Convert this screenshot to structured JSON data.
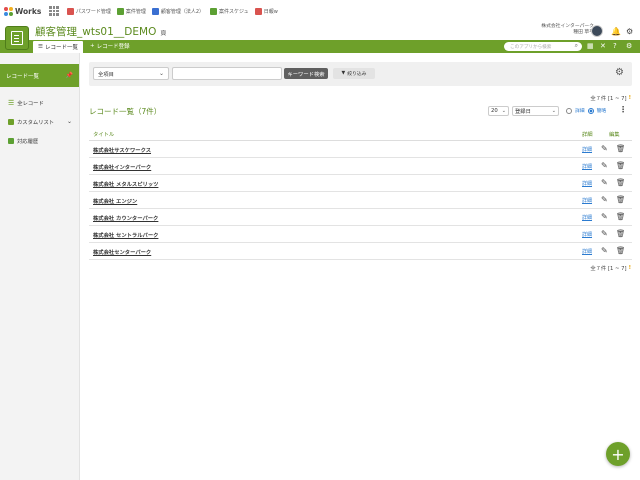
{
  "topbar": {
    "logo_text": "Works",
    "apps": [
      {
        "label": "パスワード管理",
        "color": "#d9534f"
      },
      {
        "label": "案件管理",
        "color": "#5ca033"
      },
      {
        "label": "顧客管理（法人2）",
        "color": "#3a6fd1"
      },
      {
        "label": "案件スケジュ",
        "color": "#5ca033"
      },
      {
        "label": "日報w",
        "color": "#d9534f"
      }
    ]
  },
  "header": {
    "app_title": "顧客管理_wts01__DEMO",
    "title_suffix": "頁",
    "company": "株式会社インターパーク",
    "user": "種田 草平"
  },
  "nav": {
    "tab_active": "レコード一覧",
    "tab_add": "レコード登録",
    "search_placeholder": "このアプリから検索"
  },
  "sidebar": {
    "header": "レコード一覧",
    "items": [
      {
        "label": "全レコード"
      },
      {
        "label": "カスタムリスト"
      },
      {
        "label": "対応履歴"
      }
    ]
  },
  "toolbar": {
    "field_select": "全項目",
    "keyword_button": "キーワード検索",
    "filter_button": "絞り込み"
  },
  "list": {
    "count_top": "全７件 [1 ~ 7]",
    "count_bottom": "全７件 [1 ~ 7]",
    "title": "レコード一覧（7件）",
    "per_page": "20",
    "sort": "登録日",
    "view_simple": "詳細",
    "view_detail": "簡略",
    "col_title": "タイトル",
    "col_detail": "詳細",
    "col_edit": "編集",
    "detail_link": "詳細",
    "rows": [
      "株式会社サスケワークス",
      "株式会社インターパーク",
      "株式会社 メタルスピリッツ",
      "株式会社 エンジン",
      "株式会社 カウンターパーク",
      "株式会社 セントラルパーク",
      "株式会社センターパーク"
    ]
  },
  "colors": {
    "brand_green": "#6ea02a",
    "link_blue": "#2b7bd0"
  }
}
